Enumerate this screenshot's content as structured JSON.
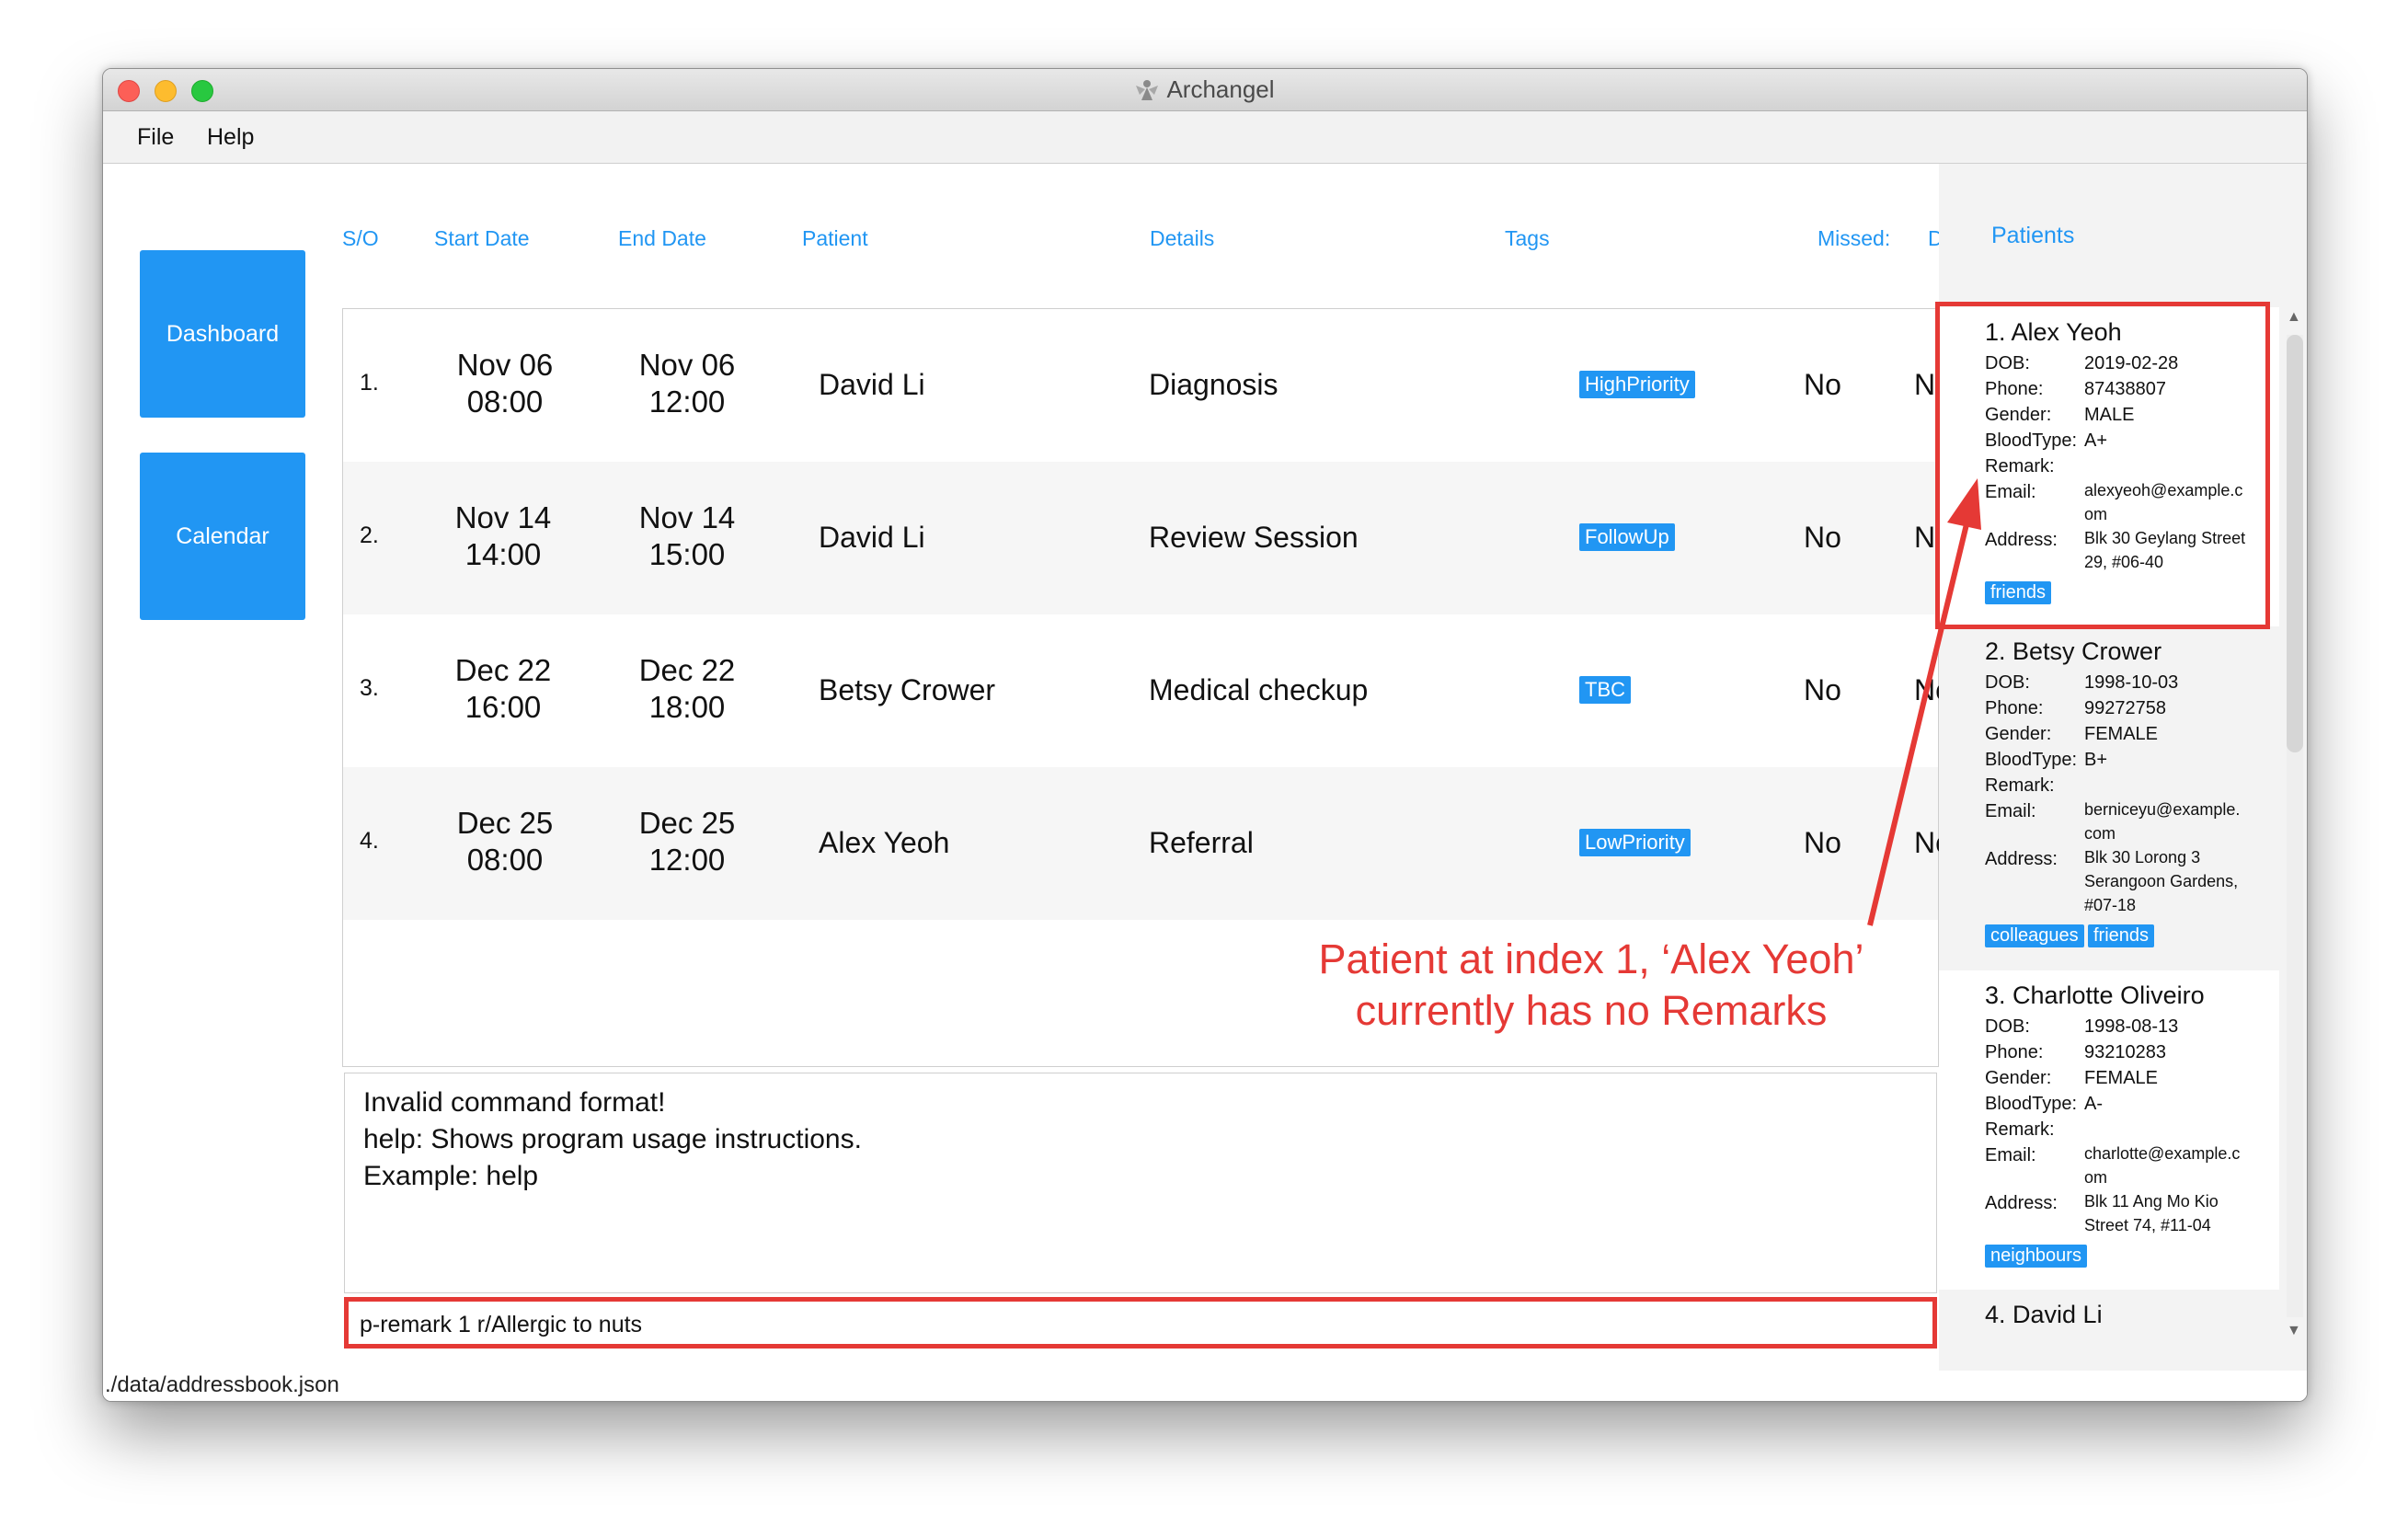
{
  "window": {
    "title": "Archangel"
  },
  "menu": [
    "File",
    "Help"
  ],
  "nav": {
    "dashboard": "Dashboard",
    "calendar": "Calendar"
  },
  "table": {
    "headers": {
      "so": "S/O",
      "start": "Start Date",
      "end": "End Date",
      "patient": "Patient",
      "details": "Details",
      "tags": "Tags",
      "missed": "Missed:",
      "done": "Done:"
    },
    "rows": [
      {
        "idx": "1.",
        "start_date": "Nov 06",
        "start_time": "08:00",
        "end_date": "Nov 06",
        "end_time": "12:00",
        "patient": "David Li",
        "details": "Diagnosis",
        "tag": "HighPriority",
        "missed": "No",
        "done": "No"
      },
      {
        "idx": "2.",
        "start_date": "Nov 14",
        "start_time": "14:00",
        "end_date": "Nov 14",
        "end_time": "15:00",
        "patient": "David Li",
        "details": "Review Session",
        "tag": "FollowUp",
        "missed": "No",
        "done": "No"
      },
      {
        "idx": "3.",
        "start_date": "Dec 22",
        "start_time": "16:00",
        "end_date": "Dec 22",
        "end_time": "18:00",
        "patient": "Betsy Crower",
        "details": "Medical checkup",
        "tag": "TBC",
        "missed": "No",
        "done": "No"
      },
      {
        "idx": "4.",
        "start_date": "Dec 25",
        "start_time": "08:00",
        "end_date": "Dec 25",
        "end_time": "12:00",
        "patient": "Alex Yeoh",
        "details": "Referral",
        "tag": "LowPriority",
        "missed": "No",
        "done": "No"
      }
    ]
  },
  "result": {
    "lines": [
      "Invalid command format!",
      "help: Shows program usage instructions.",
      "Example: help"
    ]
  },
  "command": {
    "value": "p-remark 1 r/Allergic to nuts"
  },
  "status": {
    "path": "./data/addressbook.json"
  },
  "patients": {
    "title": "Patients",
    "labels": {
      "dob": "DOB:",
      "phone": "Phone:",
      "gender": "Gender:",
      "blood": "BloodType:",
      "remark": "Remark:",
      "email": "Email:",
      "address": "Address:"
    },
    "list": [
      {
        "name": "1. Alex Yeoh",
        "dob": "2019-02-28",
        "phone": "87438807",
        "gender": "MALE",
        "blood": "A+",
        "email1": "alexyeoh@example.c",
        "email2": "om",
        "addr1": "Blk 30 Geylang Street",
        "addr2": "29, #06-40",
        "tags": [
          "friends"
        ]
      },
      {
        "name": "2. Betsy Crower",
        "dob": "1998-10-03",
        "phone": "99272758",
        "gender": "FEMALE",
        "blood": "B+",
        "email1": "berniceyu@example.",
        "email2": "com",
        "addr1": "Blk 30 Lorong 3",
        "addr2": "Serangoon Gardens,",
        "addr3": "#07-18",
        "tags": [
          "colleagues",
          "friends"
        ]
      },
      {
        "name": "3. Charlotte Oliveiro",
        "dob": "1998-08-13",
        "phone": "93210283",
        "gender": "FEMALE",
        "blood": "A-",
        "email1": "charlotte@example.c",
        "email2": "om",
        "addr1": "Blk 11 Ang Mo Kio",
        "addr2": "Street 74, #11-04",
        "tags": [
          "neighbours"
        ]
      },
      {
        "name": "4. David Li"
      }
    ]
  },
  "annotation": {
    "line1": "Patient at index 1, ‘Alex Yeoh’",
    "line2": "currently has no Remarks",
    "color": "#e53935"
  },
  "colors": {
    "accent": "#2196f3",
    "highlight": "#e53935"
  }
}
